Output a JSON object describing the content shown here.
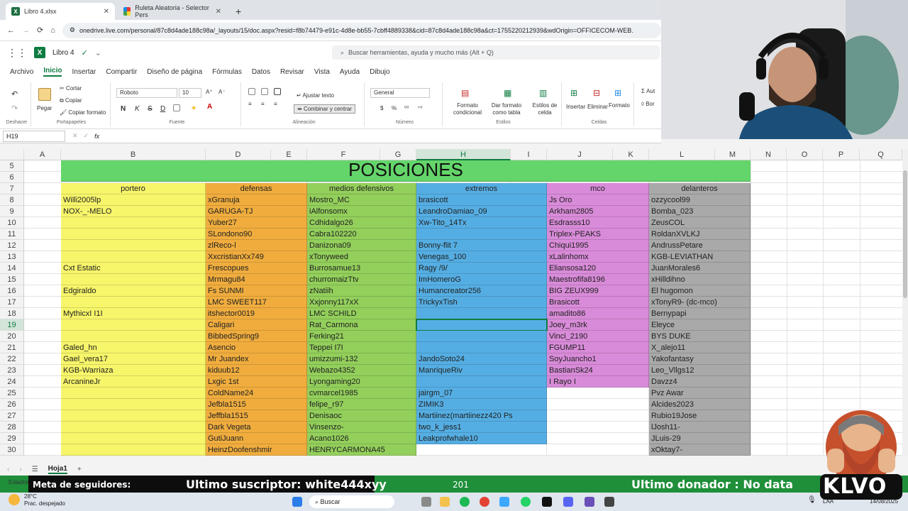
{
  "browser": {
    "tabs": [
      {
        "label": "Libro 4.xlsx",
        "icon": "excel-icon"
      },
      {
        "label": "Ruleta Aleatoria - Selector Pers",
        "icon": "roulette-icon"
      }
    ],
    "new_tab": "+",
    "url": "onedrive.live.com/personal/87c8d4ade188c98a/_layouts/15/doc.aspx?resid=f8b74479-e91c-4d8e-bb55-7cbff4889338&cid=87c8d4ade188c98a&ct=1755220212939&wdOrigin=OFFICECOM-WEB."
  },
  "app": {
    "file_name": "Libro 4",
    "search_placeholder": "Buscar herramientas, ayuda y mucho más (Alt + Q)"
  },
  "menu": [
    "Archivo",
    "Inicio",
    "Insertar",
    "Compartir",
    "Diseño de página",
    "Fórmulas",
    "Datos",
    "Revisar",
    "Vista",
    "Ayuda",
    "Dibujo"
  ],
  "ribbon": {
    "undo_label": "Deshacer",
    "clipboard": {
      "paste": "Pegar",
      "cut": "Cortar",
      "copy": "Copiar",
      "format_painter": "Copiar formato",
      "group": "Portapapeles"
    },
    "font": {
      "name": "Roboto",
      "size": "10",
      "group": "Fuente",
      "bold": "N",
      "italic": "K",
      "strike": "S",
      "underline": "D"
    },
    "alignment": {
      "wrap": "Ajustar texto",
      "merge": "Combinar y centrar",
      "group": "Alineación"
    },
    "number": {
      "format": "General",
      "group": "Número",
      "currency": "$",
      "percent": "%"
    },
    "styles": {
      "conditional": "Formato condicional",
      "table": "Dar formato como tabla",
      "cell_styles": "Estilos de celda",
      "group": "Estilos"
    },
    "cells": {
      "insert": "Insertar",
      "delete": "Eliminar",
      "format": "Formato",
      "group": "Celdas"
    },
    "extra": {
      "auto": "Aut",
      "bor": "Bor"
    }
  },
  "formula_bar": {
    "name_box": "H19",
    "fx": "fx",
    "value": ""
  },
  "sheet": {
    "columns": [
      "A",
      "B",
      "D",
      "E",
      "F",
      "G",
      "H",
      "I",
      "J",
      "K",
      "L",
      "M",
      "N",
      "O",
      "P",
      "Q"
    ],
    "selected_column": "H",
    "title": "POSICIONES",
    "headers": [
      "portero",
      "defensas",
      "medios defensivos",
      "extremos",
      "mco",
      "delanteros"
    ],
    "rows": [
      {
        "n": "8",
        "cells": [
          "Willi2005lp",
          "xGranuja",
          "Mostro_MC",
          "brasicott",
          "Js Oro",
          "ozzycool99"
        ]
      },
      {
        "n": "9",
        "cells": [
          "NOX-_-MELO",
          "GARUGA-TJ",
          "iAlfonsomx",
          "LeandroDamiao_09",
          "Arkham2805",
          "Bomba_023"
        ]
      },
      {
        "n": "10",
        "cells": [
          "",
          "Yuber27",
          "Cdhidalgo26",
          "Xw-Tito_14Tx",
          "Esdrasss10",
          "ZeusCOL"
        ]
      },
      {
        "n": "11",
        "cells": [
          "",
          "SLondono90",
          "Cabra102220",
          "",
          "Triplex-PEAKS",
          "RoldanXVLKJ"
        ]
      },
      {
        "n": "12",
        "cells": [
          "",
          "zlReco-l",
          "Danizona09",
          "Bonny-flit 7",
          "Chiqui1995",
          "AndrussPetare"
        ]
      },
      {
        "n": "13",
        "cells": [
          "",
          "XxcristianXx749",
          "xTonyweed",
          "Venegas_100",
          "xLalinhomx",
          "KGB-LEVIATHAN"
        ]
      },
      {
        "n": "14",
        "cells": [
          "Cxt Estatic",
          "Frescopues",
          "Burrosamue13",
          "Ragy /9/",
          "Eliansosa120",
          "JuanMorales6"
        ]
      },
      {
        "n": "15",
        "cells": [
          "",
          "Mrmagu84",
          "churromaizTtv",
          "ImHomeroG",
          "Maestrofifa8196",
          "xHilldihno"
        ]
      },
      {
        "n": "16",
        "cells": [
          "Edgiraldo",
          "Fs SUNMI",
          "zNatiih",
          "Humancreator256",
          "BIG ZEUX999",
          "El hugomon"
        ]
      },
      {
        "n": "17",
        "cells": [
          "",
          "LMC SWEET117",
          "Xxjonny117xX",
          "TrickyxTish",
          "Brasicott",
          "xTonyR9- (dc-mco)"
        ]
      },
      {
        "n": "18",
        "cells": [
          "MythicxI I1I",
          "itshector0019",
          "LMC SCHILD",
          "",
          "amadito86",
          "Bernypapi"
        ]
      },
      {
        "n": "19",
        "cells": [
          "",
          "Caligari",
          "Rat_Carmona",
          "",
          "Joey_m3rk",
          "Eleyce"
        ]
      },
      {
        "n": "20",
        "cells": [
          "",
          "BibbedSpring9",
          "Ferking21",
          "",
          "Vinci_2190",
          "BYS DUKE"
        ]
      },
      {
        "n": "21",
        "cells": [
          "Galed_hn",
          "Asencio",
          "Teppei I7I",
          "",
          "FGUMP11",
          "X_alejo11"
        ]
      },
      {
        "n": "22",
        "cells": [
          "Gael_vera17",
          "Mr Juandex",
          "umizzumi-132",
          "JandoSoto24",
          "SoyJuancho1",
          "Yakofantasy"
        ]
      },
      {
        "n": "23",
        "cells": [
          "KGB-Warriaza",
          "kiduub12",
          "Webazo4352",
          "ManriqueRiv",
          "BastianSk24",
          "Leo_Vllgs12"
        ]
      },
      {
        "n": "24",
        "cells": [
          "ArcanineJr",
          "Lxgic 1st",
          "Lyongaming20",
          "",
          "I Rayo I",
          "Davzz4"
        ]
      },
      {
        "n": "25",
        "cells": [
          "",
          "ColdName24",
          "cvmarcel1985",
          "jairgm_07",
          "",
          "Pvz Awar"
        ]
      },
      {
        "n": "26",
        "cells": [
          "",
          "Jefbla1515",
          "felipe_r97",
          "ZIMIK3",
          "",
          "Alcides2023"
        ]
      },
      {
        "n": "27",
        "cells": [
          "",
          "Jeffbla1515",
          "Denisaoc",
          "Martiinez(martiinezz420 Ps",
          "",
          "Rubio19Jose"
        ]
      },
      {
        "n": "28",
        "cells": [
          "",
          "Dark Vegeta",
          "Vinsenzo-",
          "two_k_jess1",
          "",
          "lJosh11-"
        ]
      },
      {
        "n": "29",
        "cells": [
          "",
          "GutiJuann",
          "Acano1026",
          "Leakprofwhale10",
          "",
          "JLuis-29"
        ]
      },
      {
        "n": "30",
        "cells": [
          "",
          "HeinzDoofenshmir",
          "HENRYCARMONA45",
          "",
          "",
          "xOktay7-"
        ]
      }
    ],
    "top_rows": [
      "5",
      "6",
      "7"
    ],
    "tab_name": "Hoja1",
    "add_sheet": "+"
  },
  "colors": {
    "title_green": "#64d56a",
    "portero": "#f7f56a",
    "defensas": "#f0ad3e",
    "medios": "#93cf5b",
    "extremos": "#55aee3",
    "mco": "#d88bd8",
    "delanteros": "#a9a9a9",
    "excel_green": "#107c41"
  },
  "stream": {
    "goal": "Meta de seguidores:",
    "subscriber": "Ultimo suscriptor: white444xyy",
    "count": "201",
    "donor": "Ultimo donador : No data",
    "logo": "KLVO"
  },
  "taskbar": {
    "weather_temp": "28°C",
    "weather_desc": "Prac. despejado",
    "status_left": "Estadíst",
    "search": "Buscar",
    "lang": "LAA",
    "date": "14/08/2025"
  }
}
